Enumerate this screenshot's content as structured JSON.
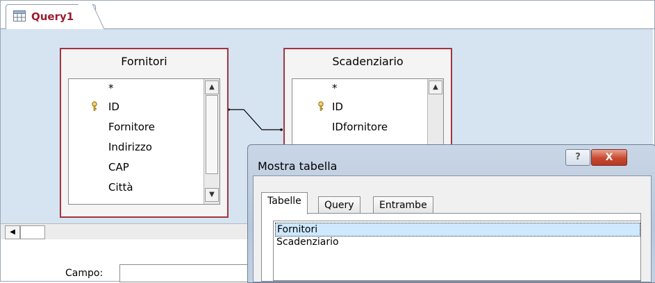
{
  "document_tab": {
    "label": "Query1"
  },
  "tables": [
    {
      "title": "Fornitori",
      "fields": [
        "*",
        "ID",
        "Fornitore",
        "Indirizzo",
        "CAP",
        "Città"
      ],
      "key_field": "ID"
    },
    {
      "title": "Scadenziario",
      "fields": [
        "*",
        "ID",
        "IDfornitore"
      ],
      "key_field": "ID"
    }
  ],
  "grid": {
    "campo_label": "Campo:",
    "campo_value": ""
  },
  "dialog": {
    "title": "Mostra tabella",
    "help_label": "?",
    "close_label": "X",
    "tabs": [
      "Tabelle",
      "Query",
      "Entrambe"
    ],
    "active_tab": "Tabelle",
    "list_items": [
      "Fornitori",
      "Scadenziario"
    ],
    "selected_item": "Fornitori"
  },
  "colors": {
    "accent": "#9b1c2e",
    "canvas": "#d6e3f1",
    "table_border": "#a2343f",
    "selection": "#cde8ff"
  },
  "icons": [
    "query-icon",
    "key-icon",
    "scroll-up-icon",
    "scroll-down-icon",
    "scroll-left-icon",
    "dropdown-icon"
  ]
}
